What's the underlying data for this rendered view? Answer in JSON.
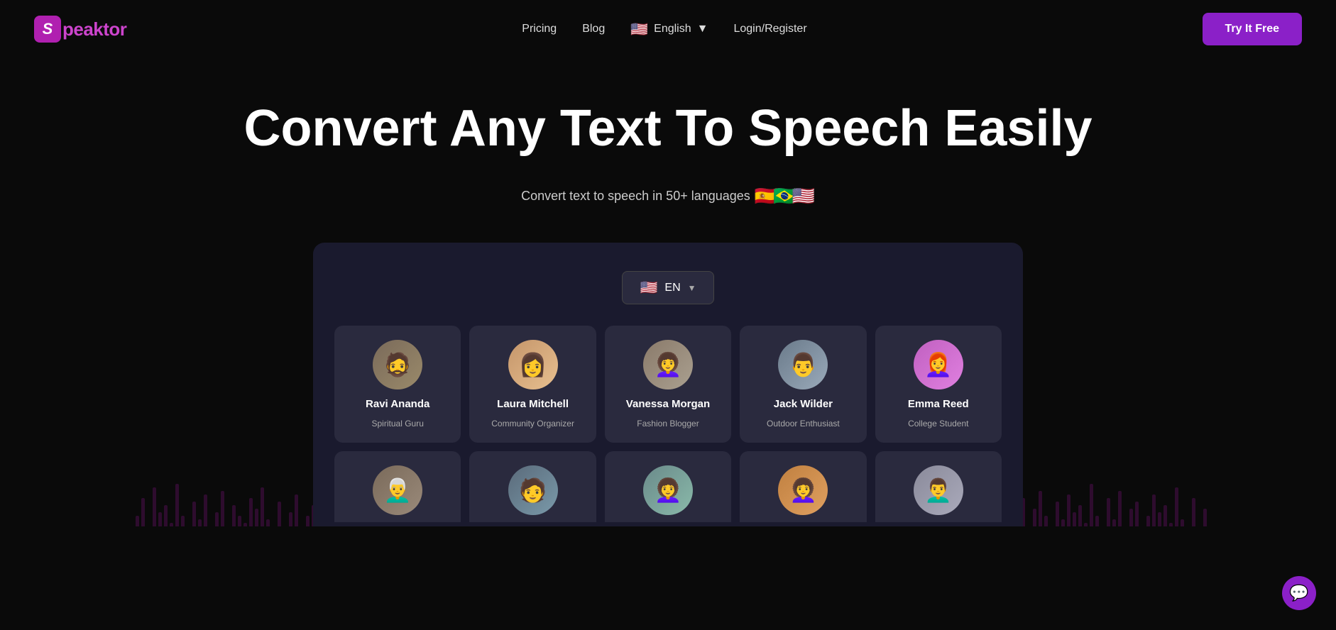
{
  "logo": {
    "letter": "S",
    "brand": "peaktor"
  },
  "navbar": {
    "pricing_label": "Pricing",
    "blog_label": "Blog",
    "language_label": "English",
    "login_label": "Login/Register",
    "try_free_label": "Try It Free",
    "lang_flag": "🇺🇸",
    "chevron": "▼"
  },
  "hero": {
    "title": "Convert Any Text To Speech Easily",
    "subtitle": "Convert text to speech in 50+ languages",
    "flags": [
      "🇪🇸",
      "🇧🇷",
      "🇺🇸"
    ]
  },
  "panel": {
    "lang_selector": {
      "flag": "🇺🇸",
      "code": "EN",
      "chevron": "▼"
    }
  },
  "voices_row1": [
    {
      "name": "Ravi Ananda",
      "role": "Spiritual Guru",
      "av_class": "av-ravi",
      "emoji": "🧔"
    },
    {
      "name": "Laura Mitchell",
      "role": "Community Organizer",
      "av_class": "av-laura",
      "emoji": "👩"
    },
    {
      "name": "Vanessa Morgan",
      "role": "Fashion Blogger",
      "av_class": "av-vanessa",
      "emoji": "👩‍🦱"
    },
    {
      "name": "Jack Wilder",
      "role": "Outdoor Enthusiast",
      "av_class": "av-jack",
      "emoji": "👨"
    },
    {
      "name": "Emma Reed",
      "role": "College Student",
      "av_class": "av-emma",
      "emoji": "👩‍🦰"
    }
  ],
  "voices_row2": [
    {
      "av_class": "av-b1",
      "emoji": "👨‍🦳"
    },
    {
      "av_class": "av-b2",
      "emoji": "🧑"
    },
    {
      "av_class": "av-b3",
      "emoji": "👩‍🦱"
    },
    {
      "av_class": "av-b4",
      "emoji": "👩‍🦱"
    },
    {
      "av_class": "av-b5",
      "emoji": "👨‍🦱"
    }
  ],
  "chat": {
    "icon": "💬"
  }
}
